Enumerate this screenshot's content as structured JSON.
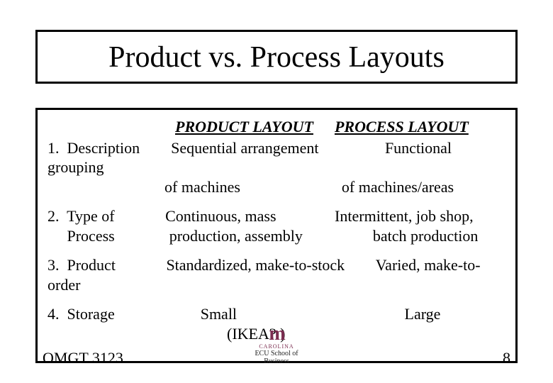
{
  "title": "Product vs. Process Layouts",
  "header_product": "PRODUCT LAYOUT",
  "header_process": "PROCESS LAYOUT",
  "rows": [
    {
      "line1": "1.  Description        Sequential arrangement                 Functional grouping",
      "line2": "                              of machines                          of machines/areas"
    },
    {
      "line1": "2.  Type of             Continuous, mass               Intermittent, job shop,",
      "line2": "     Process              production, assembly                  batch production"
    },
    {
      "line1": "3.  Product             Standardized, make-to-stock        Varied, make-to-order",
      "line2": ""
    },
    {
      "line1": "4.  Storage                      Small                                           Large",
      "line2": "                                              (IKEA? )"
    }
  ],
  "footer": {
    "left": "OMGT 3123",
    "right": "8"
  },
  "logo": {
    "glyph": "m",
    "mid": "CAROLINA",
    "bot": "ECU School of Business"
  }
}
